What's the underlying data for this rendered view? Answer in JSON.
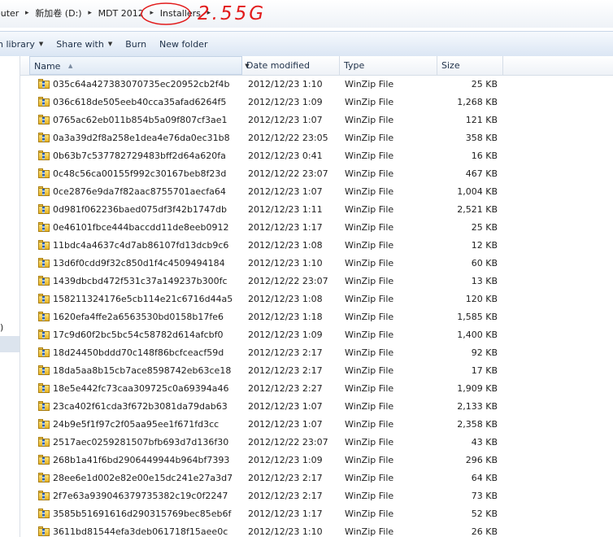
{
  "address": {
    "crumbs": [
      "outer",
      "新加卷 (D:)",
      "MDT 2012",
      "Installers"
    ],
    "annotation": "2.55G"
  },
  "toolbar": {
    "items": [
      {
        "label": "n library",
        "dropdown": true
      },
      {
        "label": "Share with",
        "dropdown": true
      },
      {
        "label": "Burn",
        "dropdown": false
      },
      {
        "label": "New folder",
        "dropdown": false
      }
    ]
  },
  "nav": {
    "partial_text": ")"
  },
  "columns": {
    "name": "Name",
    "date": "Date modified",
    "type": "Type",
    "size": "Size"
  },
  "files": [
    {
      "name": "035c64a427383070735ec20952cb2f4b",
      "date": "2012/12/23 1:10",
      "type": "WinZip File",
      "size": "25 KB"
    },
    {
      "name": "036c618de505eeb40cca35afad6264f5",
      "date": "2012/12/23 1:09",
      "type": "WinZip File",
      "size": "1,268 KB"
    },
    {
      "name": "0765ac62eb011b854b5a09f807cf3ae1",
      "date": "2012/12/23 1:07",
      "type": "WinZip File",
      "size": "121 KB"
    },
    {
      "name": "0a3a39d2f8a258e1dea4e76da0ec31b8",
      "date": "2012/12/22 23:05",
      "type": "WinZip File",
      "size": "358 KB"
    },
    {
      "name": "0b63b7c537782729483bff2d64a620fa",
      "date": "2012/12/23 0:41",
      "type": "WinZip File",
      "size": "16 KB"
    },
    {
      "name": "0c48c56ca00155f992c30167beb8f23d",
      "date": "2012/12/22 23:07",
      "type": "WinZip File",
      "size": "467 KB"
    },
    {
      "name": "0ce2876e9da7f82aac8755701aecfa64",
      "date": "2012/12/23 1:07",
      "type": "WinZip File",
      "size": "1,004 KB"
    },
    {
      "name": "0d981f062236baed075df3f42b1747db",
      "date": "2012/12/23 1:11",
      "type": "WinZip File",
      "size": "2,521 KB"
    },
    {
      "name": "0e46101fbce444baccdd11de8eeb0912",
      "date": "2012/12/23 1:17",
      "type": "WinZip File",
      "size": "25 KB"
    },
    {
      "name": "11bdc4a4637c4d7ab86107fd13dcb9c6",
      "date": "2012/12/23 1:08",
      "type": "WinZip File",
      "size": "12 KB"
    },
    {
      "name": "13d6f0cdd9f32c850d1f4c4509494184",
      "date": "2012/12/23 1:10",
      "type": "WinZip File",
      "size": "60 KB"
    },
    {
      "name": "1439dbcbd472f531c37a149237b300fc",
      "date": "2012/12/22 23:07",
      "type": "WinZip File",
      "size": "13 KB"
    },
    {
      "name": "158211324176e5cb114e21c6716d44a5",
      "date": "2012/12/23 1:08",
      "type": "WinZip File",
      "size": "120 KB"
    },
    {
      "name": "1620efa4ffe2a6563530bd0158b17fe6",
      "date": "2012/12/23 1:18",
      "type": "WinZip File",
      "size": "1,585 KB"
    },
    {
      "name": "17c9d60f2bc5bc54c58782d614afcbf0",
      "date": "2012/12/23 1:09",
      "type": "WinZip File",
      "size": "1,400 KB"
    },
    {
      "name": "18d24450bddd70c148f86bcfceacf59d",
      "date": "2012/12/23 2:17",
      "type": "WinZip File",
      "size": "92 KB"
    },
    {
      "name": "18da5aa8b15cb7ace8598742eb63ce18",
      "date": "2012/12/23 2:17",
      "type": "WinZip File",
      "size": "17 KB"
    },
    {
      "name": "18e5e442fc73caa309725c0a69394a46",
      "date": "2012/12/23 2:27",
      "type": "WinZip File",
      "size": "1,909 KB"
    },
    {
      "name": "23ca402f61cda3f672b3081da79dab63",
      "date": "2012/12/23 1:07",
      "type": "WinZip File",
      "size": "2,133 KB"
    },
    {
      "name": "24b9e5f1f97c2f05aa95ee1f671fd3cc",
      "date": "2012/12/23 1:07",
      "type": "WinZip File",
      "size": "2,358 KB"
    },
    {
      "name": "2517aec025928150 7bfb693d7d136f30",
      "date": "2012/12/22 23:07",
      "type": "WinZip File",
      "size": "43 KB"
    },
    {
      "name": "268b1a41f6bd2906449944b964bf7393",
      "date": "2012/12/23 1:09",
      "type": "WinZip File",
      "size": "296 KB"
    },
    {
      "name": "28ee6e1d002e82e00e15dc241e27a3d7",
      "date": "2012/12/23 2:17",
      "type": "WinZip File",
      "size": "64 KB"
    },
    {
      "name": "2f7e63a939046379735382c19c0f2247",
      "date": "2012/12/23 2:17",
      "type": "WinZip File",
      "size": "73 KB"
    },
    {
      "name": "3585b51691616d290315769bec85eb6f",
      "date": "2012/12/23 1:17",
      "type": "WinZip File",
      "size": "52 KB"
    },
    {
      "name": "3611bd81544efa3deb061718f15aee0c",
      "date": "2012/12/23 1:10",
      "type": "WinZip File",
      "size": "26 KB"
    }
  ],
  "colors": {
    "annotation_red": "#e21b1b",
    "toolbar_bg": "#dbe6f4",
    "selection": "#dce4ee"
  }
}
